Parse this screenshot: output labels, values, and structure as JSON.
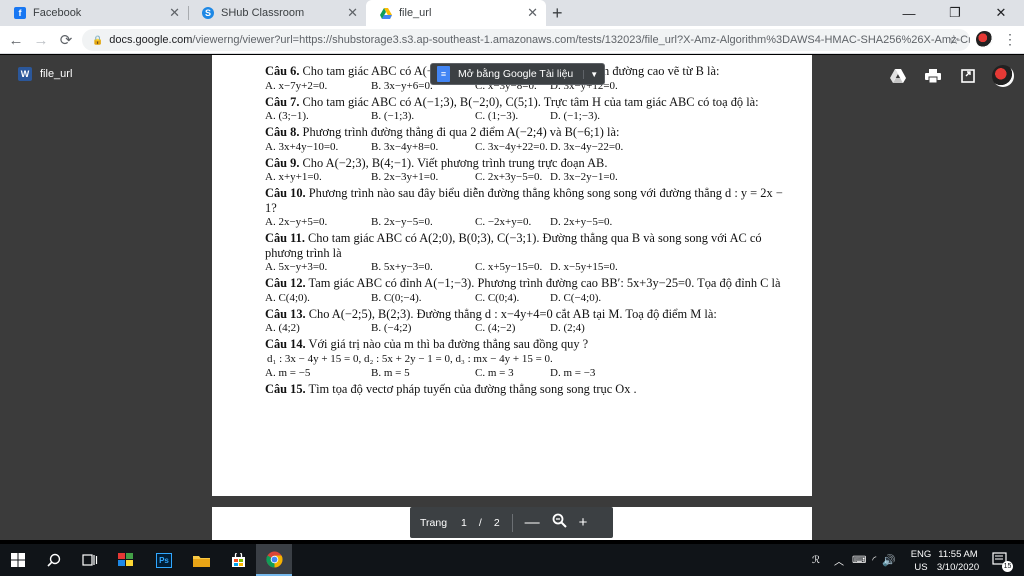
{
  "tabs": [
    {
      "label": "Facebook",
      "icon": "facebook-icon",
      "color": "#1877f2"
    },
    {
      "label": "SHub Classroom",
      "icon": "shub-icon",
      "color": "#1e88e5"
    },
    {
      "label": "file_url",
      "icon": "google-drive-icon",
      "color": "#0f9d58"
    }
  ],
  "address": {
    "host": "docs.google.com",
    "rest": "/viewerng/viewer?url=https://shubstorage3.s3.ap-southeast-1.amazonaws.com/tests/132023/file_url?X-Amz-Algorithm%3DAWS4-HMAC-SHA256%26X-Amz-Cre..."
  },
  "viewer": {
    "file_name": "file_url",
    "open_button": "Mở bằng Google Tài liệu"
  },
  "questions": [
    {
      "title": "Câu 6.",
      "text": "Cho tam giác ABC có A(−1;3), B(−2;0), C(5;1). Phương trình đường cao vẽ từ B là:",
      "options": [
        "A. x−7y+2=0.",
        "B. 3x−y+6=0.",
        "C. x−3y−8=0.",
        "D. 3x−y+12=0."
      ]
    },
    {
      "title": "Câu 7.",
      "text": "Cho tam giác ABC có A(−1;3), B(−2;0), C(5;1). Trực tâm H của tam giác ABC có toạ độ là:",
      "options": [
        "A. (3;−1).",
        "B. (−1;3).",
        "C. (1;−3).",
        "D. (−1;−3)."
      ]
    },
    {
      "title": "Câu 8.",
      "text": "Phương trình đường thẳng đi qua 2 điểm A(−2;4) và B(−6;1) là:",
      "options": [
        "A. 3x+4y−10=0.",
        "B. 3x−4y+8=0.",
        "C. 3x−4y+22=0.",
        "D. 3x−4y−22=0."
      ]
    },
    {
      "title": "Câu 9.",
      "text": "Cho A(−2;3), B(4;−1). Viết phương trình trung trực đoạn AB.",
      "options": [
        "A. x+y+1=0.",
        "B. 2x−3y+1=0.",
        "C. 2x+3y−5=0.",
        "D. 3x−2y−1=0."
      ]
    },
    {
      "title": "Câu 10.",
      "text": "Phương trình nào sau đây biểu diễn đường thẳng không song song với đường thẳng d : y = 2x − 1?",
      "options": [
        "A. 2x−y+5=0.",
        "B. 2x−y−5=0.",
        "C. −2x+y=0.",
        "D. 2x+y−5=0."
      ]
    },
    {
      "title": "Câu 11.",
      "text": "Cho tam giác ABC có A(2;0), B(0;3), C(−3;1). Đường thẳng qua B và song song với AC có phương trình là",
      "options": [
        "A. 5x−y+3=0.",
        "B. 5x+y−3=0.",
        "C. x+5y−15=0.",
        "D. x−5y+15=0."
      ]
    },
    {
      "title": "Câu 12.",
      "text": "Tam giác ABC có đỉnh A(−1;−3). Phương trình đường cao BB′: 5x+3y−25=0. Tọa độ đỉnh C là",
      "options": [
        "A. C(4;0).",
        "B. C(0;−4).",
        "C. C(0;4).",
        "D. C(−4;0)."
      ]
    },
    {
      "title": "Câu 13.",
      "text": "Cho A(−2;5), B(2;3). Đường thẳng d : x−4y+4=0 cắt AB tại M. Toạ độ điểm M là:",
      "options": [
        "A. (4;2)",
        "B. (−4;2)",
        "C. (4;−2)",
        "D. (2;4)"
      ]
    },
    {
      "title": "Câu 14.",
      "text": "Với giá trị nào của m thì ba đường thẳng sau đồng quy ?",
      "extra": "d₁ : 3x − 4y + 15 = 0,  d₂ : 5x + 2y − 1 = 0,  d₃ : mx − 4y + 15 = 0.",
      "options": [
        "A. m = −5",
        "B. m = 5",
        "C. m = 3",
        "D. m = −3"
      ]
    },
    {
      "title": "Câu 15.",
      "text": "Tìm tọa độ vectơ pháp tuyến của đường thẳng song song trục Ox .",
      "options": []
    }
  ],
  "pager": {
    "label": "Trang",
    "current": "1",
    "separator": "/",
    "total": "2"
  },
  "taskbar": {
    "lang_top": "ENG",
    "lang_bottom": "US",
    "time": "11:55 AM",
    "date": "3/10/2020",
    "notification_count": "15"
  }
}
